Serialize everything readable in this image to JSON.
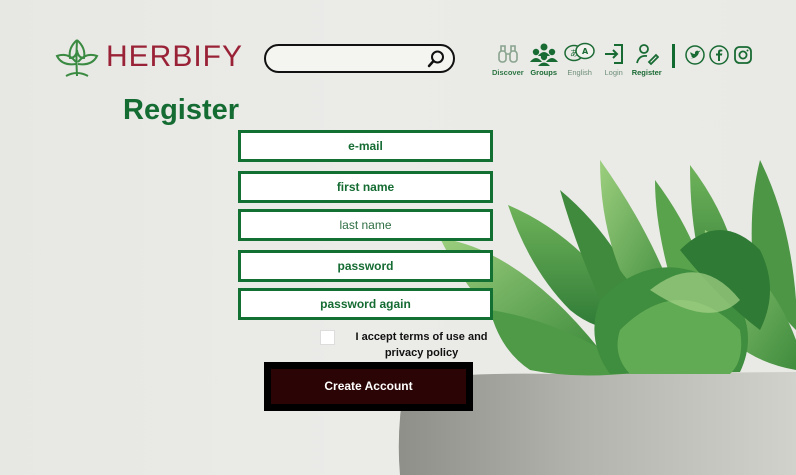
{
  "brand": {
    "name": "HERBIFY"
  },
  "search": {
    "placeholder": "",
    "value": ""
  },
  "nav": {
    "items": [
      {
        "label": "Discover",
        "icon": "binoculars-icon"
      },
      {
        "label": "Groups",
        "icon": "people-icon"
      },
      {
        "label": "English",
        "icon": "language-icon"
      },
      {
        "label": "Login",
        "icon": "login-icon"
      },
      {
        "label": "Register",
        "icon": "register-icon"
      }
    ],
    "social": [
      "twitter-icon",
      "facebook-icon",
      "instagram-icon"
    ]
  },
  "form": {
    "title": "Register",
    "fields": {
      "email": "e-mail",
      "first_name": "first name",
      "last_name": "last name",
      "password": "password",
      "password_again": "password again"
    },
    "terms_line1": "I accept terms of use and",
    "terms_line2": "privacy policy",
    "submit": "Create Account"
  },
  "colors": {
    "brand_green": "#156c33",
    "brand_red": "#9a2237",
    "button_bg": "#2b0505"
  }
}
